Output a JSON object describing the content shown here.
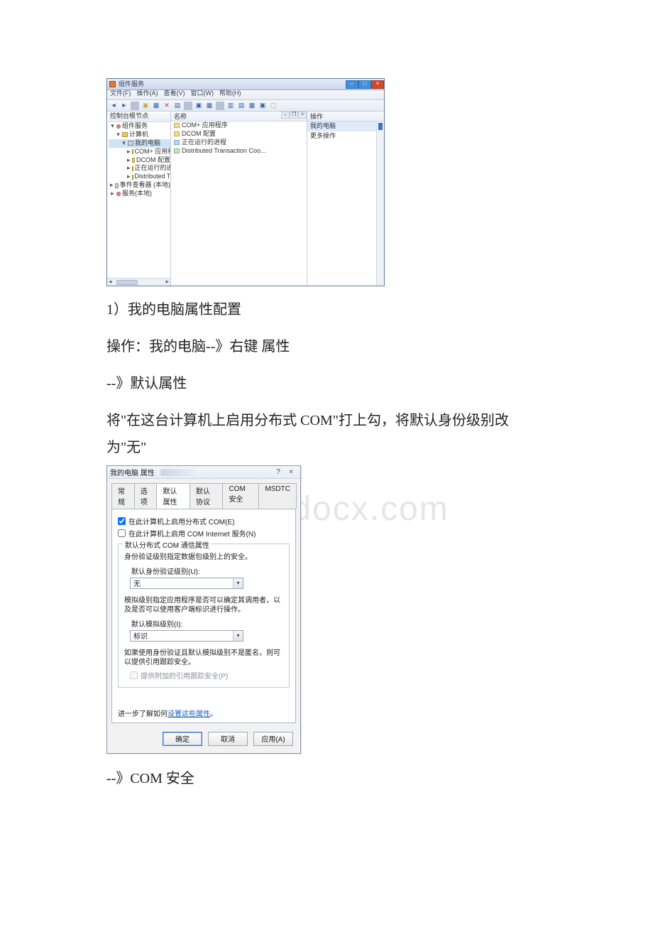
{
  "watermark": "www.bdocx.com",
  "mmc": {
    "title": "组件服务",
    "menu": {
      "file": "文件(F)",
      "action": "操作(A)",
      "view": "查看(V)",
      "window": "窗口(W)",
      "help": "帮助(H)"
    },
    "tree": {
      "root": "控制台根节点",
      "n1": "组件服务",
      "n2": "计算机",
      "n3": "我的电脑",
      "n4a": "COM+ 应用程序",
      "n4b": "DCOM 配置",
      "n4c": "正在运行的进程",
      "n4d": "Distributed Tran",
      "n5": "事件查看器 (本地)",
      "n6": "服务(本地)"
    },
    "center": {
      "hdr": "名称",
      "i1": "COM+ 应用程序",
      "i2": "DCOM 配置",
      "i3": "正在运行的进程",
      "i4": "Distributed Transaction Coo..."
    },
    "right": {
      "hdr": "操作",
      "sel": "我的电脑",
      "more": "更多操作"
    }
  },
  "text": {
    "line1": "1）我的电脑属性配置",
    "line2": "操作：我的电脑--》右键 属性",
    "line3": "--》默认属性",
    "line4": "将\"在这台计算机上启用分布式 COM\"打上勾，将默认身份级别改为\"无\"",
    "line5": "--》COM 安全"
  },
  "dlg": {
    "title": "我的电脑 属性",
    "help": "?",
    "close": "×",
    "tabs": {
      "t1": "常规",
      "t2": "选项",
      "t3": "默认属性",
      "t4": "默认协议",
      "t5": "COM 安全",
      "t6": "MSDTC"
    },
    "chk1": "在此计算机上启用分布式 COM(E)",
    "chk2": "在此计算机上启用 COM Internet 服务(N)",
    "grp_title": "默认分布式 COM 通信属性",
    "auth_desc": "身份验证级别指定数据包级别上的安全。",
    "auth_label": "默认身份验证级别(U):",
    "auth_value": "无",
    "impers_desc": "模拟级别指定应用程序是否可以确定其调用者，以及是否可以使用客户端标识进行操作。",
    "impers_label": "默认模拟级别(I):",
    "impers_value": "标识",
    "track_desc": "如果使用身份验证且默认模拟级别不是匿名，则可以提供引用跟踪安全。",
    "track_chk": "提供附加的引用跟踪安全(P)",
    "learn_prefix": "进一步了解如何",
    "learn_link": "设置这些属性",
    "learn_suffix": "。",
    "btn_ok": "确定",
    "btn_cancel": "取消",
    "btn_apply": "应用(A)"
  }
}
